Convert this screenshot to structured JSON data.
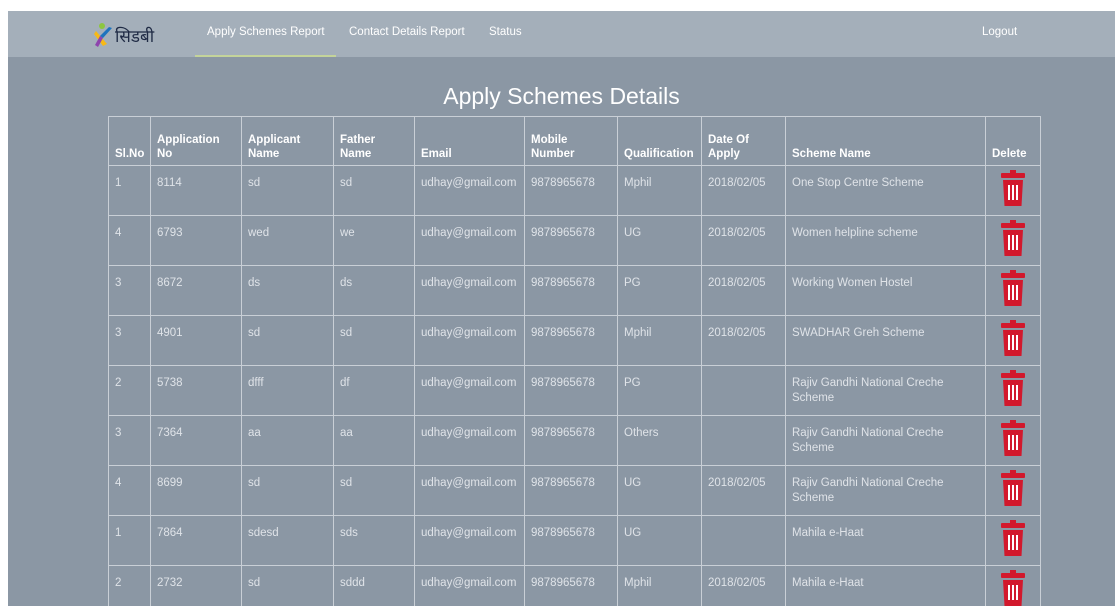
{
  "navbar": {
    "logo_text": "सिडबी",
    "items": [
      {
        "label": "Apply Schemes Report",
        "active": true
      },
      {
        "label": "Contact Details Report",
        "active": false
      },
      {
        "label": "Status",
        "active": false
      }
    ],
    "logout_label": "Logout"
  },
  "page": {
    "title": "Apply Schemes Details"
  },
  "table": {
    "headers": {
      "slno": "Sl.No",
      "app_no_1": "Application",
      "app_no_2": "No",
      "applicant_1": "Applicant",
      "applicant_2": "Name",
      "father_1": "Father",
      "father_2": "Name",
      "email": "Email",
      "mobile_1": "Mobile",
      "mobile_2": "Number",
      "qualification": "Qualification",
      "date_1": "Date Of",
      "date_2": "Apply",
      "scheme": "Scheme Name",
      "delete": "Delete"
    },
    "rows": [
      {
        "slno": "1",
        "app_no": "8114",
        "applicant": "sd",
        "father": "sd",
        "email": "udhay@gmail.com",
        "mobile": "9878965678",
        "qualification": "Mphil",
        "date": "2018/02/05",
        "scheme": "One Stop Centre Scheme"
      },
      {
        "slno": "4",
        "app_no": "6793",
        "applicant": "wed",
        "father": "we",
        "email": "udhay@gmail.com",
        "mobile": "9878965678",
        "qualification": "UG",
        "date": "2018/02/05",
        "scheme": "Women helpline scheme"
      },
      {
        "slno": "3",
        "app_no": "8672",
        "applicant": "ds",
        "father": "ds",
        "email": "udhay@gmail.com",
        "mobile": "9878965678",
        "qualification": "PG",
        "date": "2018/02/05",
        "scheme": "Working Women Hostel"
      },
      {
        "slno": "3",
        "app_no": "4901",
        "applicant": "sd",
        "father": "sd",
        "email": "udhay@gmail.com",
        "mobile": "9878965678",
        "qualification": "Mphil",
        "date": "2018/02/05",
        "scheme": "SWADHAR Greh Scheme"
      },
      {
        "slno": "2",
        "app_no": "5738",
        "applicant": "dfff",
        "father": "df",
        "email": "udhay@gmail.com",
        "mobile": "9878965678",
        "qualification": "PG",
        "date": "",
        "scheme": "Rajiv Gandhi National Creche Scheme"
      },
      {
        "slno": "3",
        "app_no": "7364",
        "applicant": "aa",
        "father": "aa",
        "email": "udhay@gmail.com",
        "mobile": "9878965678",
        "qualification": "Others",
        "date": "",
        "scheme": "Rajiv Gandhi National Creche Scheme"
      },
      {
        "slno": "4",
        "app_no": "8699",
        "applicant": "sd",
        "father": "sd",
        "email": "udhay@gmail.com",
        "mobile": "9878965678",
        "qualification": "UG",
        "date": "2018/02/05",
        "scheme": "Rajiv Gandhi National Creche Scheme"
      },
      {
        "slno": "1",
        "app_no": "7864",
        "applicant": "sdesd",
        "father": "sds",
        "email": "udhay@gmail.com",
        "mobile": "9878965678",
        "qualification": "UG",
        "date": "",
        "scheme": "Mahila e-Haat"
      },
      {
        "slno": "2",
        "app_no": "2732",
        "applicant": "sd",
        "father": "sddd",
        "email": "udhay@gmail.com",
        "mobile": "9878965678",
        "qualification": "Mphil",
        "date": "2018/02/05",
        "scheme": "Mahila e-Haat"
      }
    ]
  },
  "colors": {
    "background": "#8b97a4",
    "navbar": "#a4afba",
    "active_underline": "#c4d49a",
    "delete_icon": "#d2182c"
  },
  "icons": {
    "logo": "sidbi-logo-icon",
    "delete": "trash-icon"
  }
}
